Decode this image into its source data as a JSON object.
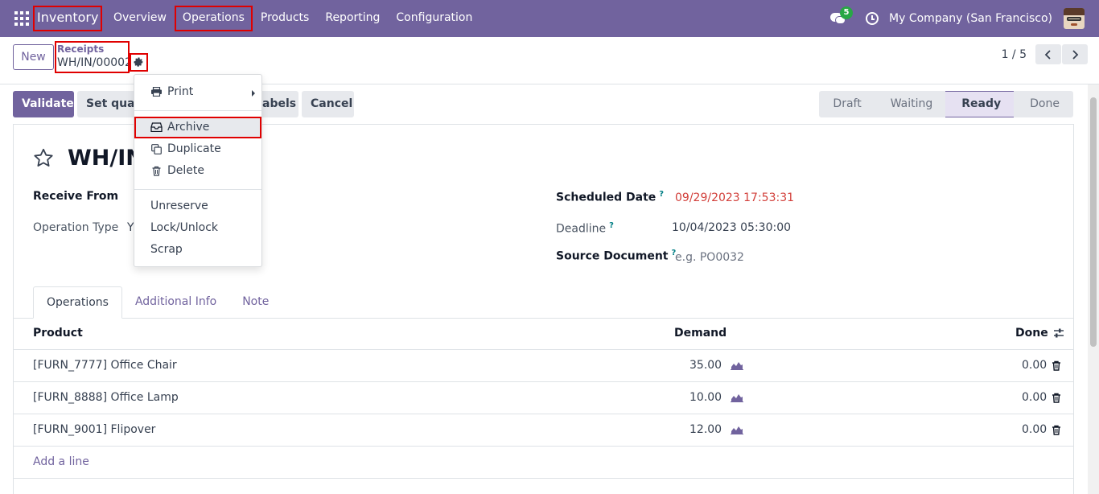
{
  "navbar": {
    "app_name": "Inventory",
    "menu": [
      "Overview",
      "Operations",
      "Products",
      "Reporting",
      "Configuration"
    ],
    "messages_count": "5",
    "company": "My Company (San Francisco)"
  },
  "control": {
    "new_label": "New",
    "breadcrumb_parent": "Receipts",
    "breadcrumb_current": "WH/IN/00002",
    "pager_value": "1 / 5"
  },
  "actions": {
    "validate": "Validate",
    "set_quantities": "Set quanti",
    "print_labels": "abels",
    "cancel": "Cancel"
  },
  "stages": [
    "Draft",
    "Waiting",
    "Ready",
    "Done"
  ],
  "active_stage": "Ready",
  "dropdown": {
    "print": "Print",
    "archive": "Archive",
    "duplicate": "Duplicate",
    "delete": "Delete",
    "unreserve": "Unreserve",
    "lock_unlock": "Lock/Unlock",
    "scrap": "Scrap"
  },
  "form": {
    "title": "WH/IN",
    "receive_from_label": "Receive From",
    "operation_type_label": "Operation Type",
    "operation_type_value": "Y",
    "scheduled_date_label": "Scheduled Date",
    "scheduled_date_value": "09/29/2023 17:53:31",
    "deadline_label": "Deadline",
    "deadline_value": "10/04/2023 05:30:00",
    "source_document_label": "Source Document",
    "source_document_placeholder": "e.g. PO0032",
    "help_mark": "?"
  },
  "tabs": [
    "Operations",
    "Additional Info",
    "Note"
  ],
  "table": {
    "headers": {
      "product": "Product",
      "demand": "Demand",
      "done": "Done"
    },
    "rows": [
      {
        "product": "[FURN_7777] Office Chair",
        "demand": "35.00",
        "done": "0.00"
      },
      {
        "product": "[FURN_8888] Office Lamp",
        "demand": "10.00",
        "done": "0.00"
      },
      {
        "product": "[FURN_9001] Flipover",
        "demand": "12.00",
        "done": "0.00"
      }
    ],
    "add_line": "Add a line"
  },
  "colors": {
    "brand": "#71639e",
    "highlight": "#e00000",
    "date_warning": "#d23f3a"
  }
}
